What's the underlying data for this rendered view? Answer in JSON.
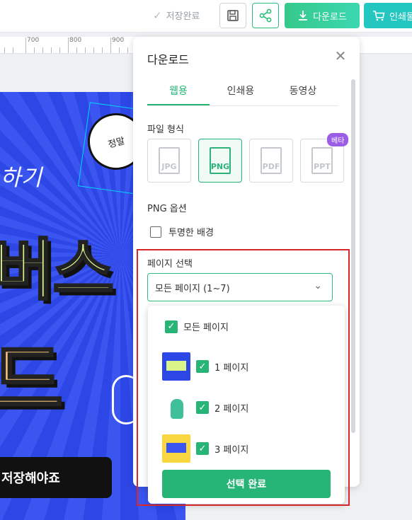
{
  "toolbar": {
    "save_status": "저장완료",
    "download_label": "다운로드",
    "print_label": "인쇄물",
    "accent": "#2ebd7d"
  },
  "ruler": {
    "ticks": [
      "700",
      "800",
      "900"
    ]
  },
  "canvas": {
    "deco_text": "하기",
    "headline_1": "버스",
    "headline_2": "드",
    "cta_text": "저장해야죠",
    "bubble_text": "정말"
  },
  "panel": {
    "title": "다운로드",
    "tabs": [
      {
        "label": "웹용",
        "active": true
      },
      {
        "label": "인쇄용",
        "active": false
      },
      {
        "label": "동영상",
        "active": false
      }
    ],
    "file_format_label": "파일 형식",
    "formats": [
      {
        "label": "JPG",
        "selected": false
      },
      {
        "label": "PNG",
        "selected": true
      },
      {
        "label": "PDF",
        "selected": false
      },
      {
        "label": "PPT",
        "selected": false
      }
    ],
    "beta_badge": "베타",
    "png_options_label": "PNG 옵션",
    "transparent_bg_label": "투명한 배경",
    "page_select_label": "페이지 선택",
    "page_select_value": "모든 페이지 (1~7)",
    "dropdown": {
      "all_pages_label": "모든 페이지",
      "pages": [
        {
          "label": "1 페이지",
          "checked": true
        },
        {
          "label": "2 페이지",
          "checked": true
        },
        {
          "label": "3 페이지",
          "checked": true
        }
      ],
      "confirm_label": "선택 완료"
    }
  }
}
